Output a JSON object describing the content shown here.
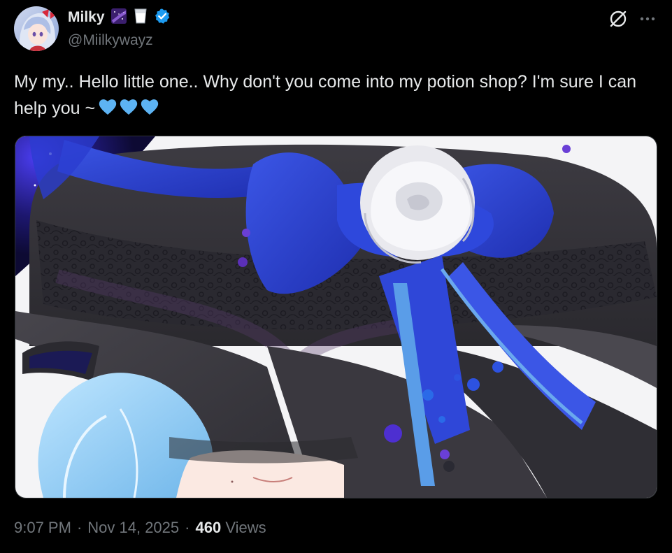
{
  "author": {
    "display_name": "Milky",
    "handle": "@Miilkywayz",
    "badge_emojis": [
      "milky-way-emoji",
      "milk-glass-emoji"
    ],
    "verified": true
  },
  "tweet": {
    "text": "My my.. Hello little one.. Why don't you come into my potion shop? I'm sure I can help you ~",
    "trailing_emojis": [
      "blue-heart",
      "blue-heart",
      "blue-heart"
    ]
  },
  "meta": {
    "time": "9:07 PM",
    "separator": "·",
    "date": "Nov 14, 2025",
    "views_count": "460",
    "views_label": "Views"
  },
  "colors": {
    "background": "#000000",
    "primary_text": "#e7e9ea",
    "secondary_text": "#71767b",
    "verified_blue": "#1d9bf0",
    "heart_blue": "#5db3f3"
  },
  "icons": {
    "grok": "grok-icon",
    "more": "more-icon",
    "verified": "verified-badge-icon"
  }
}
